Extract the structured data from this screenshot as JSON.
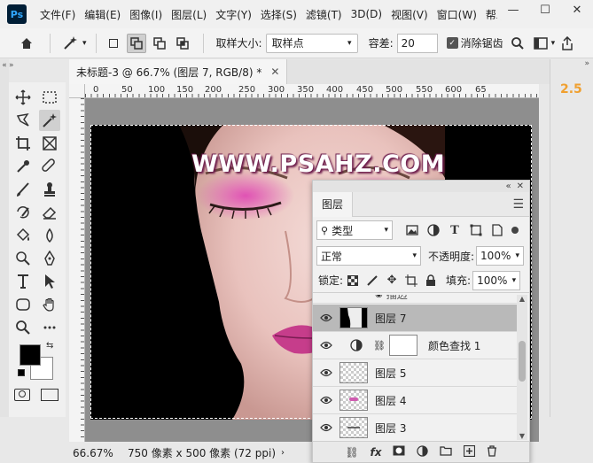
{
  "app": {
    "logo": "Ps"
  },
  "menu": [
    "文件(F)",
    "编辑(E)",
    "图像(I)",
    "图层(L)",
    "文字(Y)",
    "选择(S)",
    "滤镜(T)",
    "3D(D)",
    "视图(V)",
    "窗口(W)",
    "帮助"
  ],
  "window_controls": {
    "minimize": "—",
    "maximize": "☐",
    "close": "✕"
  },
  "options": {
    "sample_size_label": "取样大小:",
    "sample_size_value": "取样点",
    "tolerance_label": "容差:",
    "tolerance_value": "20",
    "antialias_label": "消除锯齿",
    "antialias_checked": true
  },
  "document": {
    "tab_title": "未标题-3 @ 66.7% (图层 7, RGB/8) *",
    "watermark": "WWW.PSAHZ.COM"
  },
  "ruler": {
    "ticks": [
      "0",
      "50",
      "100",
      "150",
      "200",
      "250",
      "300",
      "350",
      "400",
      "450",
      "500",
      "550",
      "600",
      "65"
    ]
  },
  "right_strip": {
    "value": "2.5"
  },
  "status": {
    "zoom": "66.67%",
    "size": "750 像素 x 500 像素 (72 ppi)"
  },
  "layers_panel": {
    "tab": "图层",
    "filter_kind": "类型",
    "blend_mode": "正常",
    "opacity_label": "不透明度:",
    "opacity_value": "100%",
    "lock_label": "锁定:",
    "fill_label": "填充:",
    "fill_value": "100%",
    "partial_layer": "描边",
    "layers": [
      {
        "name": "图层 7",
        "selected": true,
        "type": "mask"
      },
      {
        "name": "颜色查找 1",
        "selected": false,
        "type": "adjustment"
      },
      {
        "name": "图层 5",
        "selected": false,
        "type": "pixel"
      },
      {
        "name": "图层 4",
        "selected": false,
        "type": "pixel"
      },
      {
        "name": "图层 3",
        "selected": false,
        "type": "pixel"
      }
    ],
    "footer_icons": [
      "link-icon",
      "fx-icon",
      "mask-icon",
      "adjustment-icon",
      "folder-icon",
      "new-layer-icon",
      "trash-icon"
    ],
    "fx_label": "fx"
  },
  "colors": {
    "foreground": "#000000",
    "background": "#ffffff",
    "selection_highlight": "#b9b9b9",
    "accent_orange": "#f0a030"
  }
}
